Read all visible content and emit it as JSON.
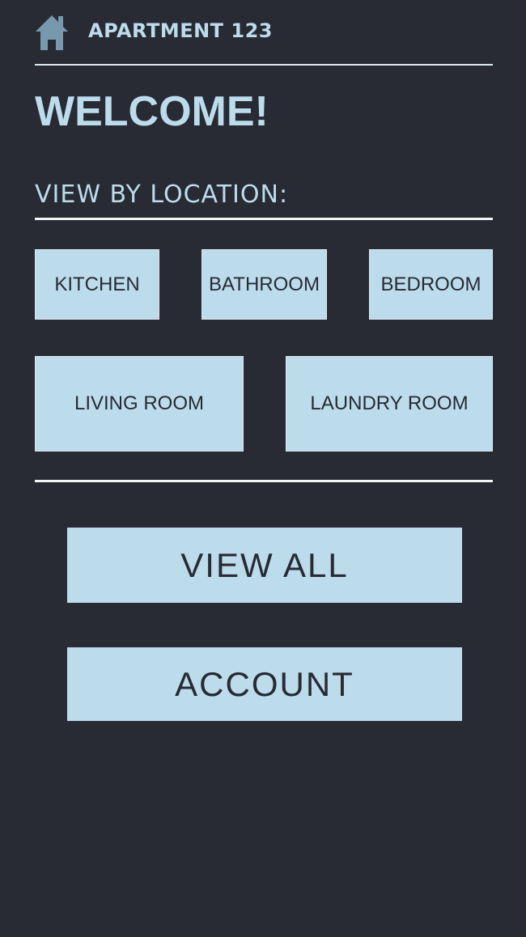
{
  "header": {
    "icon": "home-icon",
    "title": "APARTMENT 123"
  },
  "welcome": "WELCOME!",
  "location_section": {
    "heading": "VIEW BY LOCATION:",
    "locations": [
      "KITCHEN",
      "BATHROOM",
      "BEDROOM",
      "LIVING ROOM",
      "LAUNDRY ROOM"
    ]
  },
  "actions": {
    "view_all": "VIEW ALL",
    "account": "ACCOUNT"
  },
  "colors": {
    "background": "#282a34",
    "accent": "#bcdcec",
    "text_dark": "#282a34",
    "rule": "#f2f4f6",
    "icon": "#7899ad"
  }
}
